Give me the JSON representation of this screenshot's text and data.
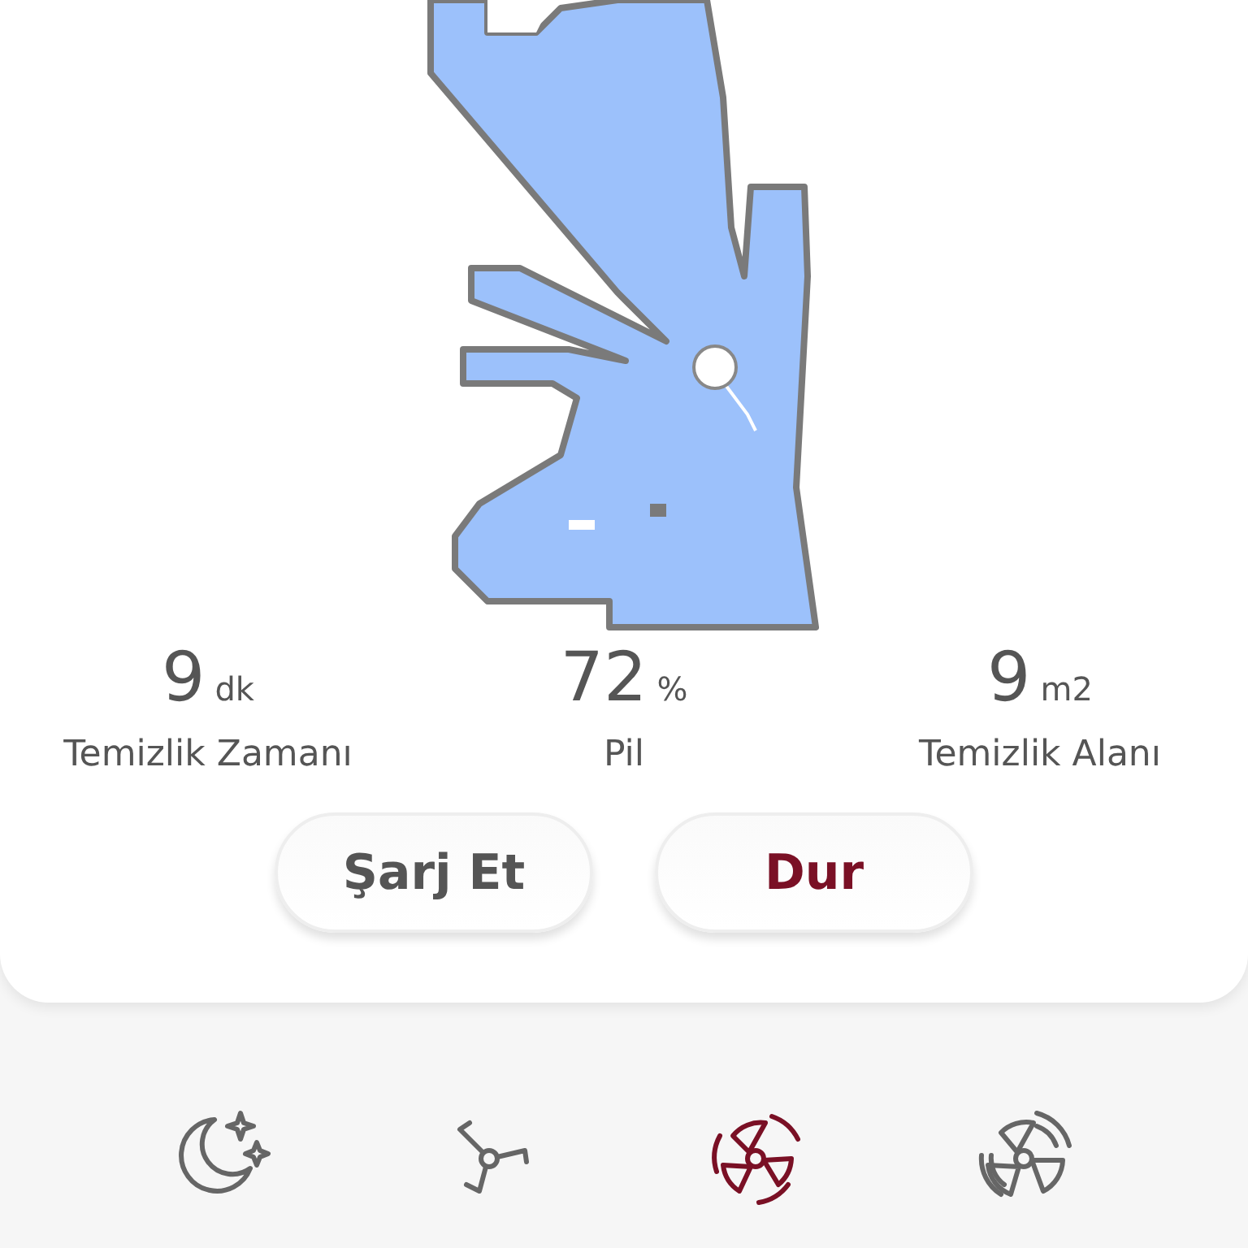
{
  "stats": [
    {
      "value": "9",
      "unit": "dk",
      "label": "Temizlik Zamanı"
    },
    {
      "value": "72",
      "unit": "%",
      "label": "Pil"
    },
    {
      "value": "9",
      "unit": "m2",
      "label": "Temizlik Alanı"
    }
  ],
  "buttons": [
    {
      "label": "Şarj Et",
      "kind": "neutral"
    },
    {
      "label": "Dur",
      "kind": "stop"
    }
  ],
  "modes": [
    {
      "kind": "quiet",
      "selected": false
    },
    {
      "kind": "standard",
      "selected": false
    },
    {
      "kind": "strong",
      "selected": true
    },
    {
      "kind": "turbo",
      "selected": false
    }
  ]
}
